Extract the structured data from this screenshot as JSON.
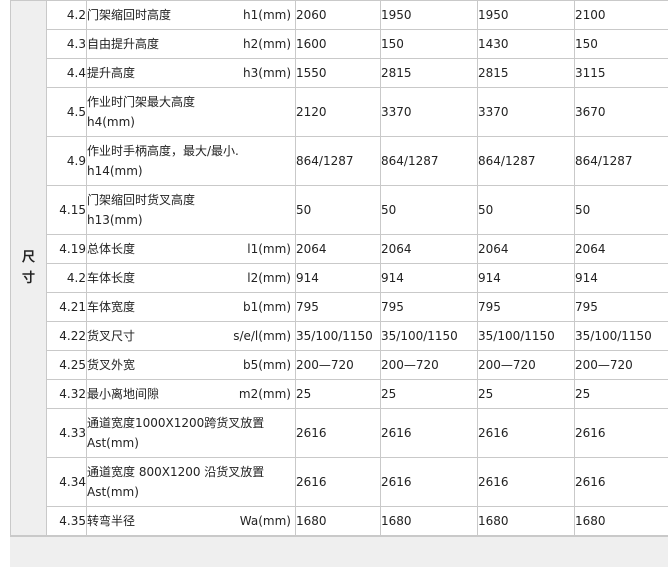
{
  "category": {
    "line1": "尺",
    "line2": "寸"
  },
  "rows": [
    {
      "num": "4.2",
      "name": "门架缩回时高度",
      "sym": "h1(mm)",
      "two": false,
      "vals": [
        "2060",
        "1950",
        "1950",
        "2100"
      ]
    },
    {
      "num": "4.3",
      "name": "自由提升高度",
      "sym": "h2(mm)",
      "two": false,
      "vals": [
        "1600",
        "150",
        "1430",
        "150"
      ]
    },
    {
      "num": "4.4",
      "name": "提升高度",
      "sym": "h3(mm)",
      "two": false,
      "vals": [
        "1550",
        "2815",
        "2815",
        "3115"
      ]
    },
    {
      "num": "4.5",
      "name": "作业时门架最大高度",
      "sym": "h4(mm)",
      "two": true,
      "vals": [
        "2120",
        "3370",
        "3370",
        "3670"
      ]
    },
    {
      "num": "4.9",
      "name": "作业时手柄高度，最大/最小.",
      "sym": "h14(mm)",
      "two": true,
      "vals": [
        "864/1287",
        "864/1287",
        "864/1287",
        "864/1287"
      ]
    },
    {
      "num": "4.15",
      "name": "门架缩回时货叉高度",
      "sym": "h13(mm)",
      "two": true,
      "vals": [
        "50",
        "50",
        "50",
        "50"
      ]
    },
    {
      "num": "4.19",
      "name": "总体长度",
      "sym": "l1(mm)",
      "two": false,
      "vals": [
        "2064",
        "2064",
        "2064",
        "2064"
      ]
    },
    {
      "num": "4.2",
      "name": "车体长度",
      "sym": "l2(mm)",
      "two": false,
      "vals": [
        "914",
        "914",
        "914",
        "914"
      ]
    },
    {
      "num": "4.21",
      "name": "车体宽度",
      "sym": "b1(mm)",
      "two": false,
      "vals": [
        "795",
        "795",
        "795",
        "795"
      ]
    },
    {
      "num": "4.22",
      "name": "货叉尺寸",
      "sym": "s/e/l(mm)",
      "two": false,
      "vals": [
        "35/100/1150",
        "35/100/1150",
        "35/100/1150",
        "35/100/1150"
      ]
    },
    {
      "num": "4.25",
      "name": "货叉外宽",
      "sym": "b5(mm)",
      "two": false,
      "vals": [
        "200—720",
        "200—720",
        "200—720",
        "200—720"
      ]
    },
    {
      "num": "4.32",
      "name": "最小离地间隙",
      "sym": "m2(mm)",
      "two": false,
      "vals": [
        "25",
        "25",
        "25",
        "25"
      ]
    },
    {
      "num": "4.33",
      "name": "通道宽度1000X1200跨货叉放置",
      "sym": "Ast(mm)",
      "two": true,
      "vals": [
        "2616",
        "2616",
        "2616",
        "2616"
      ]
    },
    {
      "num": "4.34",
      "name": "通道宽度 800X1200 沿货叉放置",
      "sym": "Ast(mm)",
      "two": true,
      "vals": [
        "2616",
        "2616",
        "2616",
        "2616"
      ]
    },
    {
      "num": "4.35",
      "name": "转弯半径",
      "sym": "Wa(mm)",
      "two": false,
      "vals": [
        "1680",
        "1680",
        "1680",
        "1680"
      ]
    }
  ]
}
